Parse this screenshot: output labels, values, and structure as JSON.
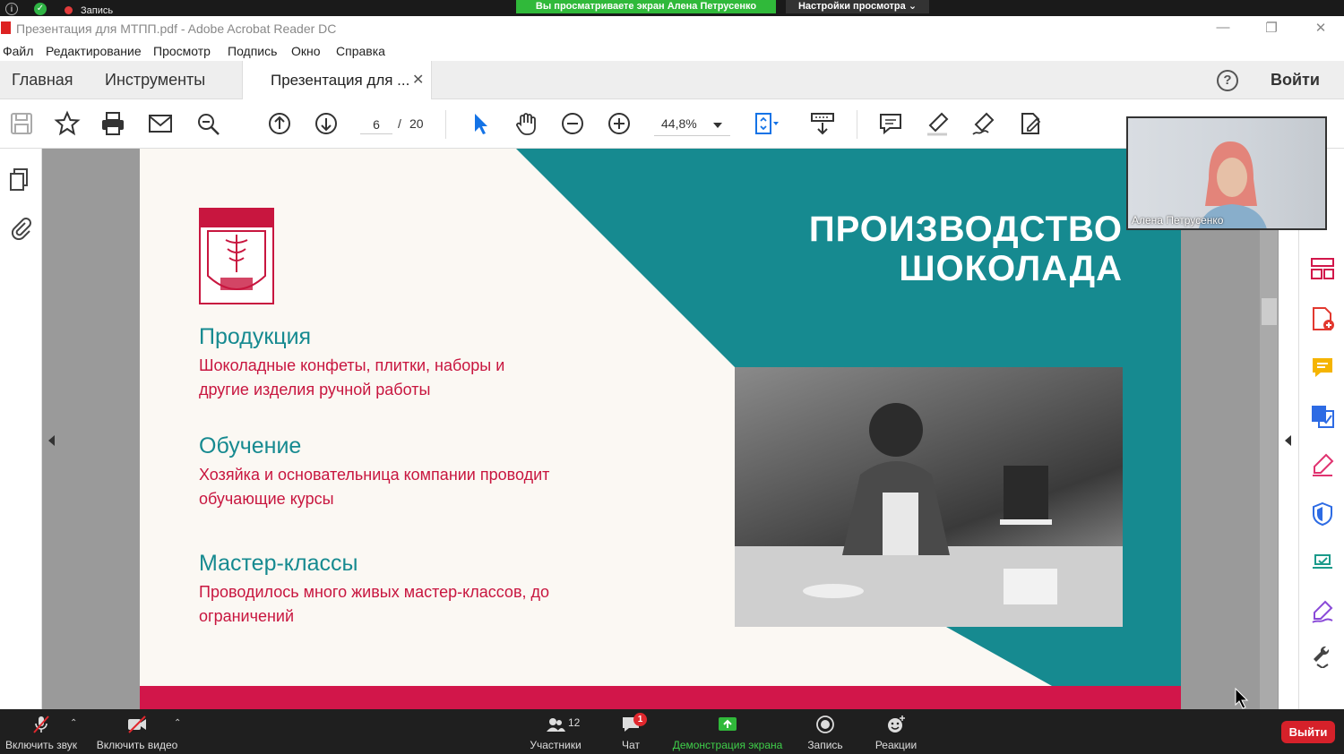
{
  "zoom_top": {
    "recording_label": "Запись",
    "viewing_banner": "Вы просматриваете экран Алена Петрусенко",
    "view_settings": "Настройки просмотра ⌄"
  },
  "window": {
    "title": "Презентация для МТПП.pdf - Adobe Acrobat Reader DC",
    "minimize": "—",
    "restore": "❐",
    "close": "✕"
  },
  "menu": [
    "Файл",
    "Редактирование",
    "Просмотр",
    "Подпись",
    "Окно",
    "Справка"
  ],
  "tabs": {
    "home": "Главная",
    "tools": "Инструменты",
    "document": "Презентация для ...",
    "close": "✕",
    "help": "?",
    "login": "Войти"
  },
  "toolbar": {
    "current_page": "6",
    "separator": "/",
    "total_pages": "20",
    "zoom": "44,8%"
  },
  "slide": {
    "title_line1": "ПРОИЗВОДСТВО",
    "title_line2": "ШОКОЛАДА",
    "sections": [
      {
        "heading": "Продукция",
        "text": "Шоколадные конфеты, плитки, наборы и другие изделия ручной работы"
      },
      {
        "heading": "Обучение",
        "text": "Хозяйка и основательница компании проводит обучающие курсы"
      },
      {
        "heading": "Мастер-классы",
        "text": "Проводилось много живых мастер-классов, до ограничений"
      }
    ],
    "colors": {
      "teal": "#168a90",
      "crimson": "#c8163f",
      "background": "#fbf8f3"
    }
  },
  "video": {
    "participant_name": "Алена Петрусенко"
  },
  "zoom_bottom": {
    "unmute": "Включить звук",
    "start_video": "Включить видео",
    "participants": "Участники",
    "participants_count": "12",
    "chat": "Чат",
    "chat_badge": "1",
    "share_screen": "Демонстрация экрана",
    "record": "Запись",
    "reactions": "Реакции",
    "exit": "Выйти"
  }
}
